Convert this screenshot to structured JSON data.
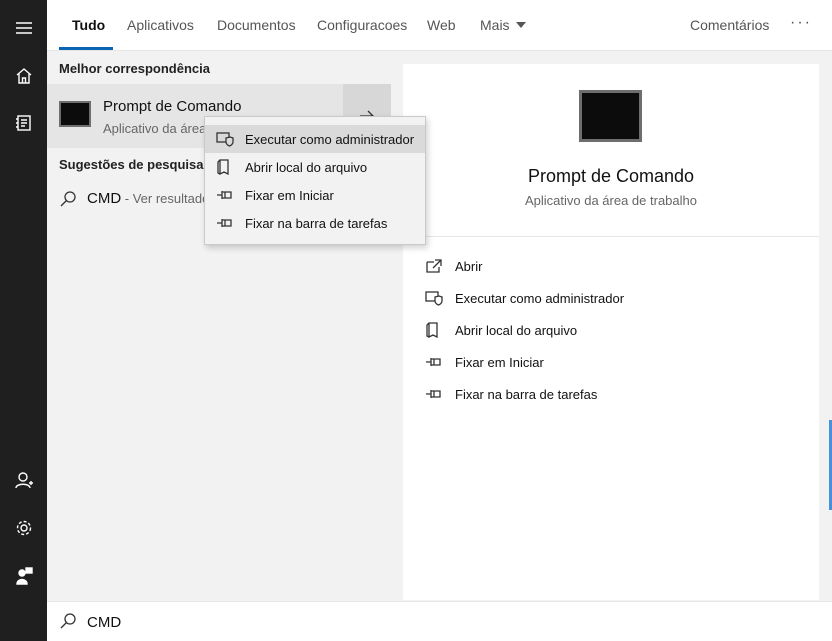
{
  "rail": {
    "items": [
      {
        "icon": "hamburger-menu-icon"
      },
      {
        "icon": "home-icon"
      },
      {
        "icon": "document-icon"
      },
      {
        "icon": "add-user-icon"
      },
      {
        "icon": "gear-icon"
      },
      {
        "icon": "feedback-user-icon"
      }
    ]
  },
  "tabs": {
    "items": [
      "Tudo",
      "Aplicativos",
      "Documentos",
      "Configuracoes",
      "Web",
      "Mais"
    ],
    "active": "Tudo",
    "feedback": "Comentários",
    "more_options": "···"
  },
  "results": {
    "best_match_label": "Melhor correspondência",
    "best_match": {
      "title": "Prompt de Comando",
      "subtitle": "Aplicativo da área"
    },
    "suggestions_label": "Sugestões de pesquisa",
    "suggestion": {
      "term": "CMD",
      "hint": " - Ver resultado"
    }
  },
  "context_menu": {
    "items": [
      {
        "label": "Executar como administrador",
        "icon": "shield-admin-icon"
      },
      {
        "label": "Abrir local do arquivo",
        "icon": "file-location-icon"
      },
      {
        "label": "Fixar em Iniciar",
        "icon": "pin-icon"
      },
      {
        "label": "Fixar na barra de tarefas",
        "icon": "pin-icon"
      }
    ]
  },
  "detail": {
    "title": "Prompt de Comando",
    "subtitle": "Aplicativo da área de trabalho",
    "actions": [
      {
        "label": "Abrir",
        "icon": "open-icon"
      },
      {
        "label": "Executar como administrador",
        "icon": "shield-admin-icon"
      },
      {
        "label": "Abrir local do arquivo",
        "icon": "file-location-icon"
      },
      {
        "label": "Fixar em Iniciar",
        "icon": "pin-icon"
      },
      {
        "label": "Fixar na barra de tarefas",
        "icon": "pin-icon"
      }
    ]
  },
  "search": {
    "value": "CMD",
    "placeholder": ""
  },
  "colors": {
    "accent": "#0a64b4",
    "rail_bg": "#1f1f1f",
    "pane_bg": "#f2f2f2",
    "selected_bg": "#e5e5e5"
  }
}
